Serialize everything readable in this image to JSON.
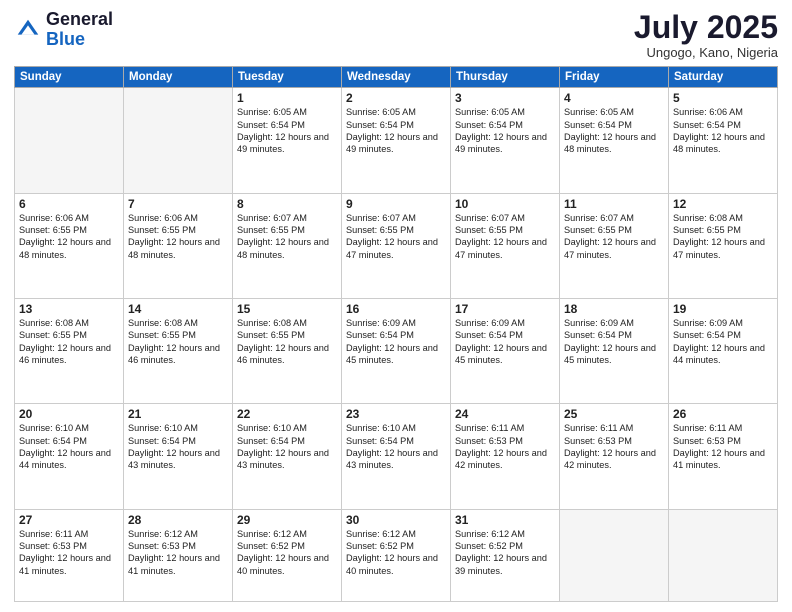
{
  "header": {
    "logo": {
      "line1": "General",
      "line2": "Blue"
    },
    "title": "July 2025",
    "subtitle": "Ungogo, Kano, Nigeria"
  },
  "days_of_week": [
    "Sunday",
    "Monday",
    "Tuesday",
    "Wednesday",
    "Thursday",
    "Friday",
    "Saturday"
  ],
  "weeks": [
    [
      {
        "day": "",
        "empty": true
      },
      {
        "day": "",
        "empty": true
      },
      {
        "day": "1",
        "sunrise": "6:05 AM",
        "sunset": "6:54 PM",
        "daylight": "12 hours and 49 minutes."
      },
      {
        "day": "2",
        "sunrise": "6:05 AM",
        "sunset": "6:54 PM",
        "daylight": "12 hours and 49 minutes."
      },
      {
        "day": "3",
        "sunrise": "6:05 AM",
        "sunset": "6:54 PM",
        "daylight": "12 hours and 49 minutes."
      },
      {
        "day": "4",
        "sunrise": "6:05 AM",
        "sunset": "6:54 PM",
        "daylight": "12 hours and 48 minutes."
      },
      {
        "day": "5",
        "sunrise": "6:06 AM",
        "sunset": "6:54 PM",
        "daylight": "12 hours and 48 minutes."
      }
    ],
    [
      {
        "day": "6",
        "sunrise": "6:06 AM",
        "sunset": "6:55 PM",
        "daylight": "12 hours and 48 minutes."
      },
      {
        "day": "7",
        "sunrise": "6:06 AM",
        "sunset": "6:55 PM",
        "daylight": "12 hours and 48 minutes."
      },
      {
        "day": "8",
        "sunrise": "6:07 AM",
        "sunset": "6:55 PM",
        "daylight": "12 hours and 48 minutes."
      },
      {
        "day": "9",
        "sunrise": "6:07 AM",
        "sunset": "6:55 PM",
        "daylight": "12 hours and 47 minutes."
      },
      {
        "day": "10",
        "sunrise": "6:07 AM",
        "sunset": "6:55 PM",
        "daylight": "12 hours and 47 minutes."
      },
      {
        "day": "11",
        "sunrise": "6:07 AM",
        "sunset": "6:55 PM",
        "daylight": "12 hours and 47 minutes."
      },
      {
        "day": "12",
        "sunrise": "6:08 AM",
        "sunset": "6:55 PM",
        "daylight": "12 hours and 47 minutes."
      }
    ],
    [
      {
        "day": "13",
        "sunrise": "6:08 AM",
        "sunset": "6:55 PM",
        "daylight": "12 hours and 46 minutes."
      },
      {
        "day": "14",
        "sunrise": "6:08 AM",
        "sunset": "6:55 PM",
        "daylight": "12 hours and 46 minutes."
      },
      {
        "day": "15",
        "sunrise": "6:08 AM",
        "sunset": "6:55 PM",
        "daylight": "12 hours and 46 minutes."
      },
      {
        "day": "16",
        "sunrise": "6:09 AM",
        "sunset": "6:54 PM",
        "daylight": "12 hours and 45 minutes."
      },
      {
        "day": "17",
        "sunrise": "6:09 AM",
        "sunset": "6:54 PM",
        "daylight": "12 hours and 45 minutes."
      },
      {
        "day": "18",
        "sunrise": "6:09 AM",
        "sunset": "6:54 PM",
        "daylight": "12 hours and 45 minutes."
      },
      {
        "day": "19",
        "sunrise": "6:09 AM",
        "sunset": "6:54 PM",
        "daylight": "12 hours and 44 minutes."
      }
    ],
    [
      {
        "day": "20",
        "sunrise": "6:10 AM",
        "sunset": "6:54 PM",
        "daylight": "12 hours and 44 minutes."
      },
      {
        "day": "21",
        "sunrise": "6:10 AM",
        "sunset": "6:54 PM",
        "daylight": "12 hours and 43 minutes."
      },
      {
        "day": "22",
        "sunrise": "6:10 AM",
        "sunset": "6:54 PM",
        "daylight": "12 hours and 43 minutes."
      },
      {
        "day": "23",
        "sunrise": "6:10 AM",
        "sunset": "6:54 PM",
        "daylight": "12 hours and 43 minutes."
      },
      {
        "day": "24",
        "sunrise": "6:11 AM",
        "sunset": "6:53 PM",
        "daylight": "12 hours and 42 minutes."
      },
      {
        "day": "25",
        "sunrise": "6:11 AM",
        "sunset": "6:53 PM",
        "daylight": "12 hours and 42 minutes."
      },
      {
        "day": "26",
        "sunrise": "6:11 AM",
        "sunset": "6:53 PM",
        "daylight": "12 hours and 41 minutes."
      }
    ],
    [
      {
        "day": "27",
        "sunrise": "6:11 AM",
        "sunset": "6:53 PM",
        "daylight": "12 hours and 41 minutes."
      },
      {
        "day": "28",
        "sunrise": "6:12 AM",
        "sunset": "6:53 PM",
        "daylight": "12 hours and 41 minutes."
      },
      {
        "day": "29",
        "sunrise": "6:12 AM",
        "sunset": "6:52 PM",
        "daylight": "12 hours and 40 minutes."
      },
      {
        "day": "30",
        "sunrise": "6:12 AM",
        "sunset": "6:52 PM",
        "daylight": "12 hours and 40 minutes."
      },
      {
        "day": "31",
        "sunrise": "6:12 AM",
        "sunset": "6:52 PM",
        "daylight": "12 hours and 39 minutes."
      },
      {
        "day": "",
        "empty": true
      },
      {
        "day": "",
        "empty": true
      }
    ]
  ],
  "labels": {
    "sunrise_prefix": "Sunrise: ",
    "sunset_prefix": "Sunset: ",
    "daylight_prefix": "Daylight: "
  }
}
